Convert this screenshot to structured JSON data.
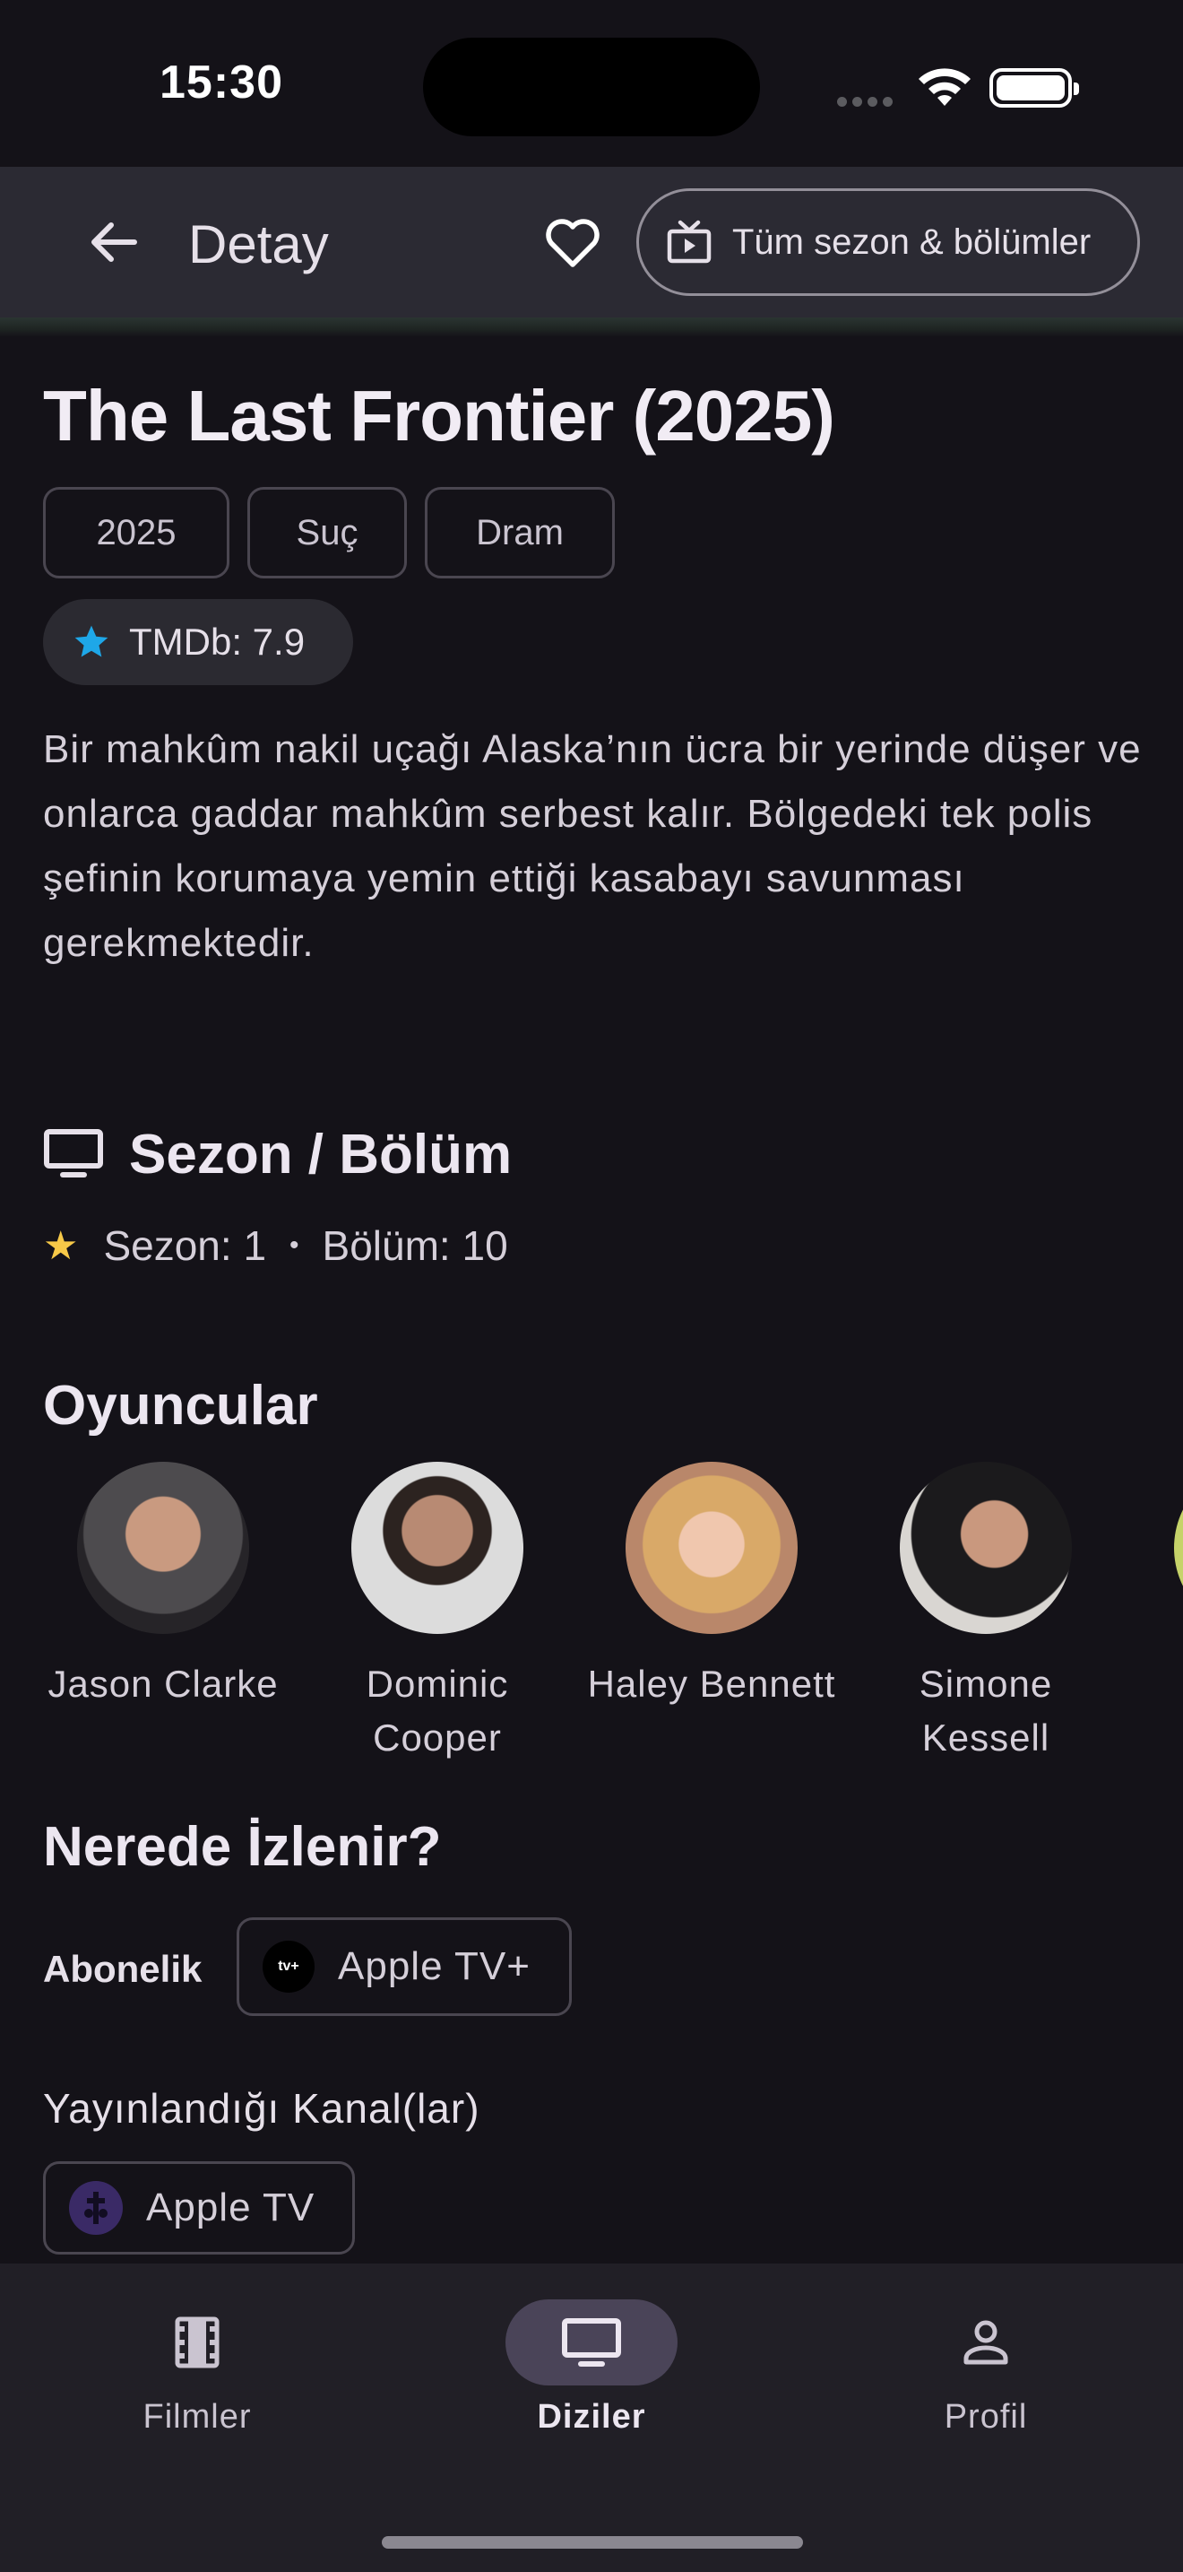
{
  "status_bar": {
    "time": "15:30"
  },
  "app_bar": {
    "title": "Detay",
    "seasons_button_label": "Tüm sezon & bölümler"
  },
  "show": {
    "title": "The Last Frontier (2025)",
    "chips": [
      "2025",
      "Suç",
      "Dram"
    ],
    "rating": "TMDb: 7.9",
    "overview": "Bir mahkûm nakil uçağı Alaska’nın ücra bir yerinde düşer ve onlarca gaddar mahkûm serbest kalır. Bölgedeki tek polis şefinin korumaya yemin ettiği kasabayı savunması gerekmektedir."
  },
  "season_section": {
    "title": "Sezon / Bölüm",
    "season": "Sezon: 1",
    "separator": "•",
    "episode": "Bölüm: 10"
  },
  "cast_section": {
    "title": "Oyuncular",
    "members": [
      {
        "name": "Jason Clarke"
      },
      {
        "name": "Dominic Cooper"
      },
      {
        "name": "Haley Bennett"
      },
      {
        "name": "Simone Kessell"
      }
    ]
  },
  "where_section": {
    "title": "Nerede İzlenir?",
    "subscription_label": "Abonelik",
    "subscription_provider": "Apple TV+",
    "provider_logo_text": "tv+",
    "channels_label": "Yayınlandığı Kanal(lar)",
    "channel": "Apple TV"
  },
  "bottom_nav": {
    "items": [
      {
        "label": "Filmler",
        "icon": "film-icon",
        "active": false
      },
      {
        "label": "Diziler",
        "icon": "tv-icon",
        "active": true
      },
      {
        "label": "Profil",
        "icon": "person-icon",
        "active": false
      }
    ]
  },
  "colors": {
    "background": "#141218",
    "app_bar": "#2b2a33",
    "accent_star": "#1ea7e8",
    "active_nav": "#4a4458"
  }
}
